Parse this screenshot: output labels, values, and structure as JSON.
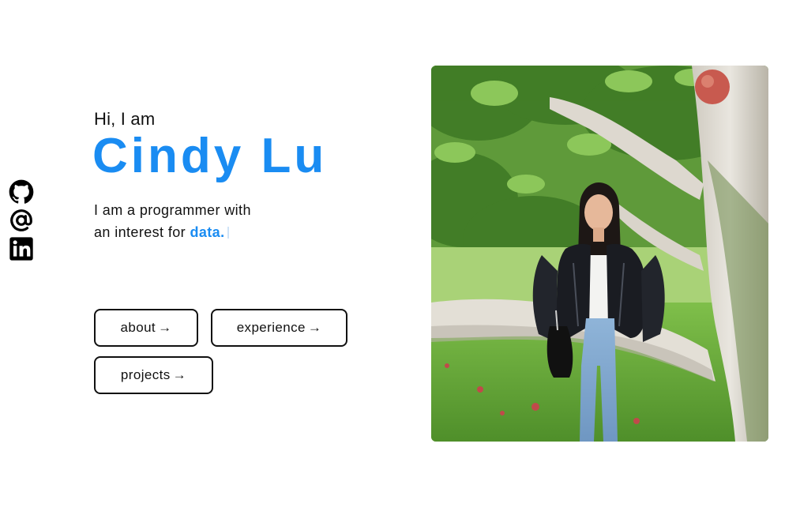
{
  "social": [
    {
      "name": "github-icon"
    },
    {
      "name": "email-icon"
    },
    {
      "name": "linkedin-icon"
    }
  ],
  "intro": {
    "greeting": "Hi, I am",
    "name": "Cindy Lu",
    "tagline_line1": "I am a programmer with",
    "tagline_prefix": "an interest for ",
    "tagline_highlight": "data."
  },
  "buttons": {
    "about": "about",
    "experience": "experience",
    "projects": "projects",
    "arrow": "→"
  },
  "colors": {
    "accent": "#1a8cf2",
    "text": "#111111",
    "background": "#ffffff"
  }
}
